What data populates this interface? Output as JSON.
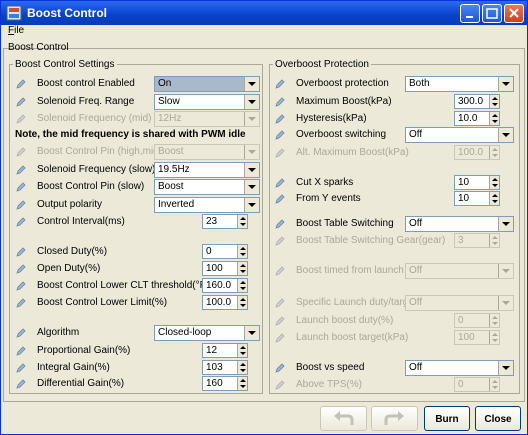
{
  "window": {
    "title": "Boost Control"
  },
  "menu": {
    "file": "File"
  },
  "outer_group_title": "Boost Control",
  "left": {
    "title": "Boost Control Settings",
    "boost_enabled": {
      "label": "Boost control Enabled",
      "value": "On"
    },
    "solenoid_range": {
      "label": "Solenoid Freq. Range",
      "value": "Slow"
    },
    "solenoid_mid": {
      "label": "Solenoid Frequency (mid)",
      "value": "12Hz"
    },
    "note": "Note, the mid frequency is shared with PWM idle",
    "pin_highmid": {
      "label": "Boost Control Pin (high,mid)",
      "value": "Boost"
    },
    "solenoid_slow": {
      "label": "Solenoid Frequency (slow)",
      "value": "19.5Hz"
    },
    "pin_slow": {
      "label": "Boost Control Pin (slow)",
      "value": "Boost"
    },
    "polarity": {
      "label": "Output polarity",
      "value": "Inverted"
    },
    "interval": {
      "label": "Control Interval(ms)",
      "value": "23"
    },
    "closed_duty": {
      "label": "Closed Duty(%)",
      "value": "0"
    },
    "open_duty": {
      "label": "Open Duty(%)",
      "value": "100"
    },
    "clt_threshold": {
      "label": "Boost Control Lower CLT threshold(°F)",
      "value": "160.0"
    },
    "lower_limit": {
      "label": "Boost Control Lower Limit(%)",
      "value": "100.0"
    },
    "algorithm": {
      "label": "Algorithm",
      "value": "Closed-loop"
    },
    "p_gain": {
      "label": "Proportional Gain(%)",
      "value": "12"
    },
    "i_gain": {
      "label": "Integral Gain(%)",
      "value": "103"
    },
    "d_gain": {
      "label": "Differential Gain(%)",
      "value": "160"
    }
  },
  "right": {
    "title": "Overboost Protection",
    "overboost": {
      "label": "Overboost protection",
      "value": "Both"
    },
    "max_boost": {
      "label": "Maximum Boost(kPa)",
      "value": "300.0"
    },
    "hysteresis": {
      "label": "Hysteresis(kPa)",
      "value": "10.0"
    },
    "ob_switching": {
      "label": "Overboost switching",
      "value": "Off"
    },
    "alt_max": {
      "label": "Alt. Maximum Boost(kPa)",
      "value": "100.0"
    },
    "cut_x": {
      "label": "Cut X sparks",
      "value": "10"
    },
    "from_y": {
      "label": "From Y events",
      "value": "10"
    },
    "table_switching": {
      "label": "Boost Table Switching",
      "value": "Off"
    },
    "table_gear": {
      "label": "Boost Table Switching Gear(gear)",
      "value": "3"
    },
    "timed_launch": {
      "label": "Boost timed from launch",
      "value": "Off"
    },
    "specific_launch": {
      "label": "Specific Launch duty/target",
      "value": "Off"
    },
    "launch_duty": {
      "label": "Launch boost duty(%)",
      "value": "0"
    },
    "launch_target": {
      "label": "Launch boost target(kPa)",
      "value": "100"
    },
    "vs_speed": {
      "label": "Boost vs speed",
      "value": "Off"
    },
    "above_tps": {
      "label": "Above TPS(%)",
      "value": "0"
    }
  },
  "buttons": {
    "burn": "Burn",
    "close": "Close"
  },
  "colors": {
    "title_bar": "#0842c8",
    "face": "#ece9d8",
    "selected_combo": "#aab8cc"
  }
}
